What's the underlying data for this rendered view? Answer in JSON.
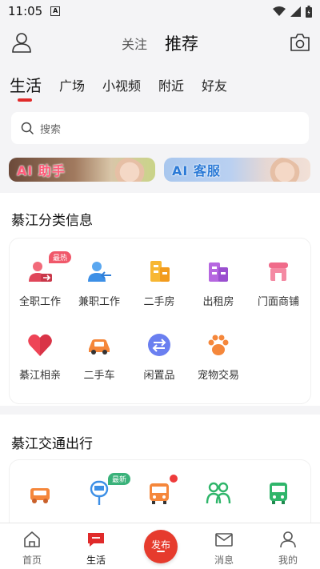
{
  "status_bar": {
    "time": "11:05",
    "a_icon": "A"
  },
  "top_nav": {
    "follow": "关注",
    "recommend": "推荐"
  },
  "category_tabs": [
    "生活",
    "广场",
    "小视频",
    "附近",
    "好友"
  ],
  "search": {
    "placeholder": "搜索"
  },
  "banners": [
    {
      "label": "AI 助手"
    },
    {
      "label": "AI 客服"
    }
  ],
  "classified": {
    "title": "綦江分类信息",
    "items": [
      {
        "label": "全职工作",
        "icon": "job-transfer-icon",
        "badge": "最热"
      },
      {
        "label": "兼职工作",
        "icon": "user-arrow-icon"
      },
      {
        "label": "二手房",
        "icon": "building-icon"
      },
      {
        "label": "出租房",
        "icon": "apartment-icon"
      },
      {
        "label": "门面商铺",
        "icon": "shop-icon"
      },
      {
        "label": "綦江相亲",
        "icon": "heart-icon"
      },
      {
        "label": "二手车",
        "icon": "car-icon"
      },
      {
        "label": "闲置品",
        "icon": "exchange-icon"
      },
      {
        "label": "宠物交易",
        "icon": "paw-icon"
      }
    ]
  },
  "transport": {
    "title": "綦江交通出行",
    "items": [
      {
        "icon": "taxi-icon"
      },
      {
        "icon": "bus-stop-icon",
        "badge": "最新"
      },
      {
        "icon": "bus-icon",
        "red_dot": true
      },
      {
        "icon": "people-icon"
      },
      {
        "icon": "coach-icon"
      }
    ]
  },
  "bottom_nav": {
    "items": [
      {
        "label": "首页",
        "icon": "home-icon"
      },
      {
        "label": "生活",
        "icon": "chat-bubble-icon"
      },
      {
        "label": "",
        "icon": ""
      },
      {
        "label": "消息",
        "icon": "mail-icon"
      },
      {
        "label": "我的",
        "icon": "profile-icon"
      }
    ],
    "publish_label": "发布"
  },
  "colors": {
    "accent": "#e02a2a",
    "publish": "#e63b2d"
  }
}
